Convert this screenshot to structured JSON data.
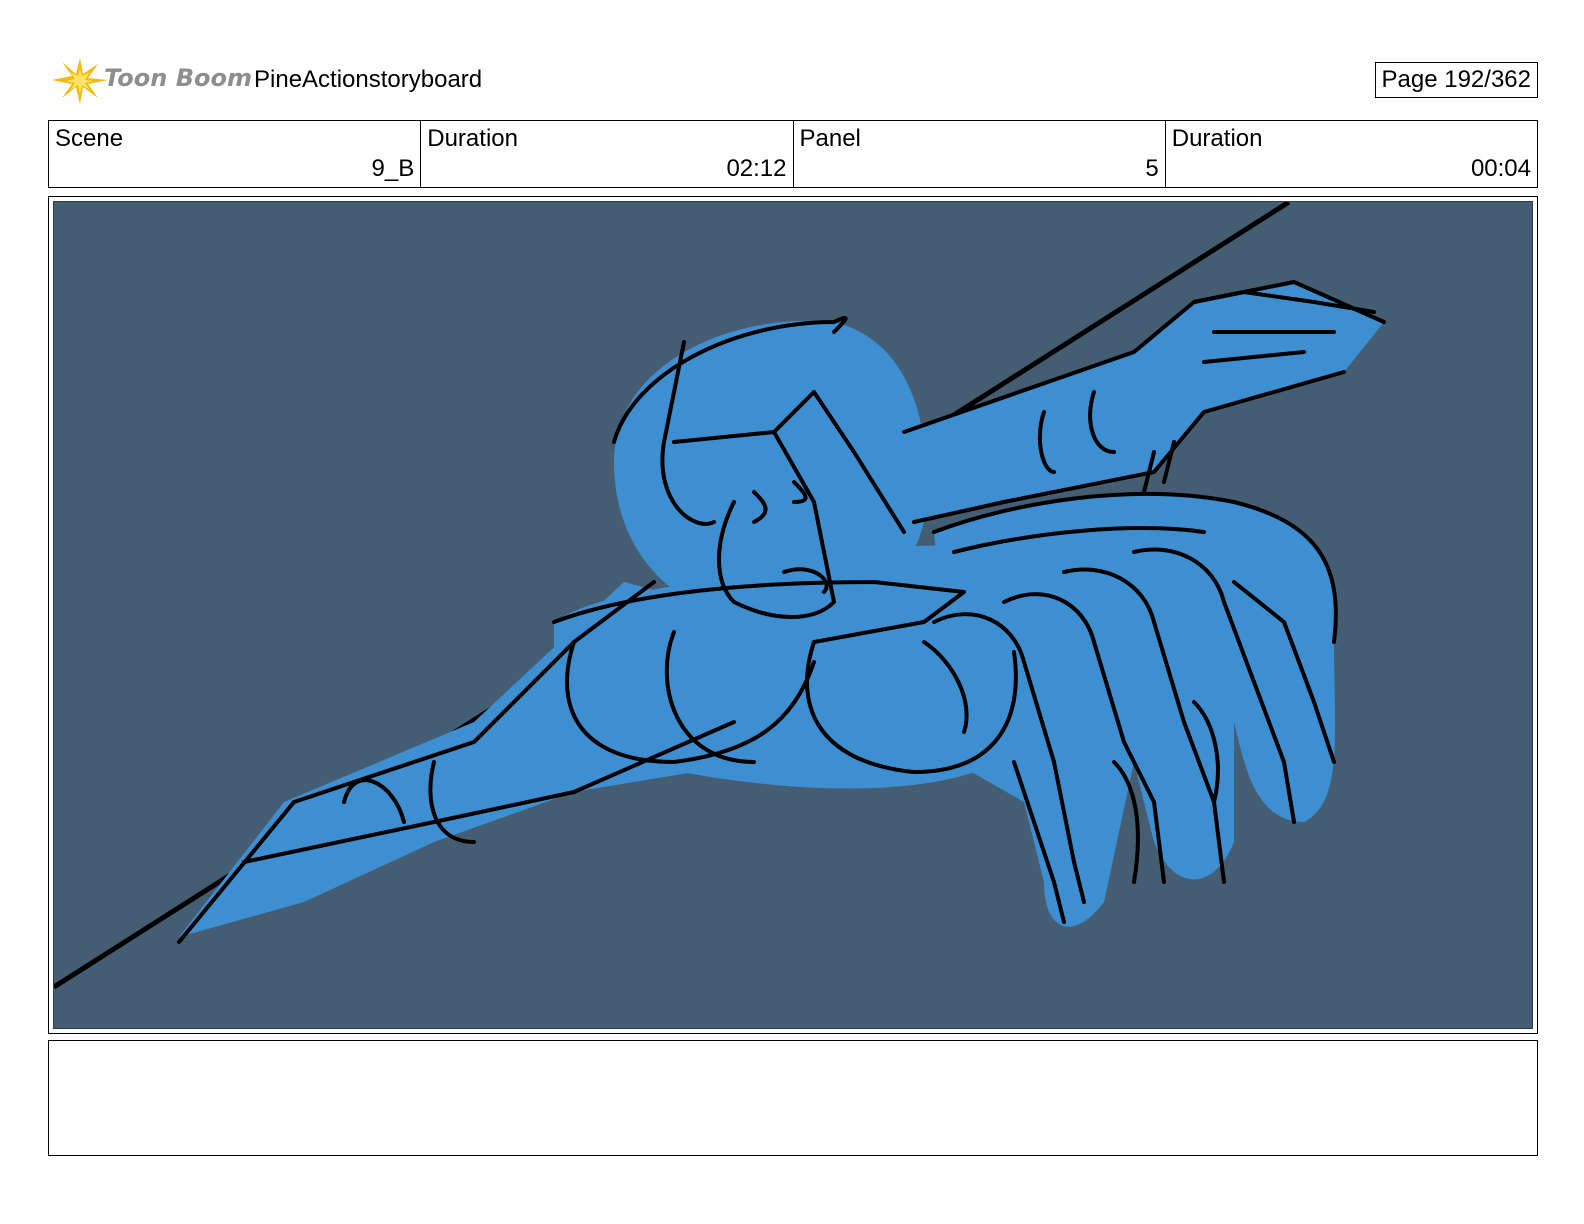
{
  "header": {
    "logo_text": "Toon Boom",
    "project_title": "PineActionstoryboard",
    "page_label": "Page 192/362"
  },
  "info": {
    "scene_label": "Scene",
    "scene_value": "9_B",
    "scene_duration_label": "Duration",
    "scene_duration_value": "02:12",
    "panel_label": "Panel",
    "panel_value": "5",
    "panel_duration_label": "Duration",
    "panel_duration_value": "00:04"
  },
  "notes": {
    "text": ""
  },
  "colors": {
    "panel_background": "#455d72",
    "figure_fill": "#3d8fd1",
    "ink": "#000000",
    "logo_accent": "#f5b800",
    "logo_text": "#8e8e8e"
  }
}
